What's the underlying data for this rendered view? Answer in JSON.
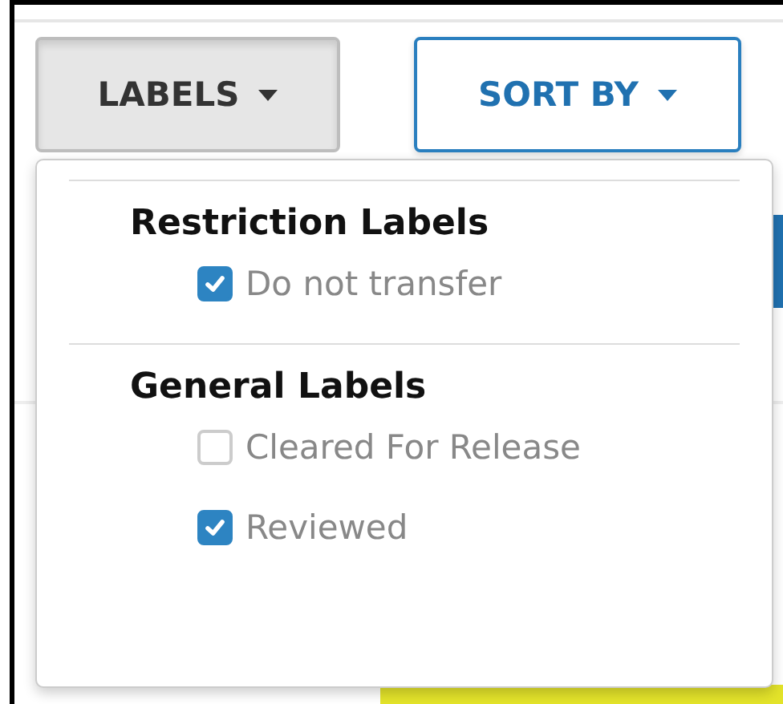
{
  "toolbar": {
    "labels_button": {
      "label": "LABELS",
      "expanded": true
    },
    "sort_button": {
      "label": "SORT BY"
    }
  },
  "labels_menu": {
    "groups": [
      {
        "title": "Restriction Labels",
        "items": [
          {
            "label": "Do not transfer",
            "checked": true
          }
        ]
      },
      {
        "title": "General Labels",
        "items": [
          {
            "label": "Cleared For Release",
            "checked": false
          },
          {
            "label": "Reviewed",
            "checked": true
          }
        ]
      }
    ]
  }
}
